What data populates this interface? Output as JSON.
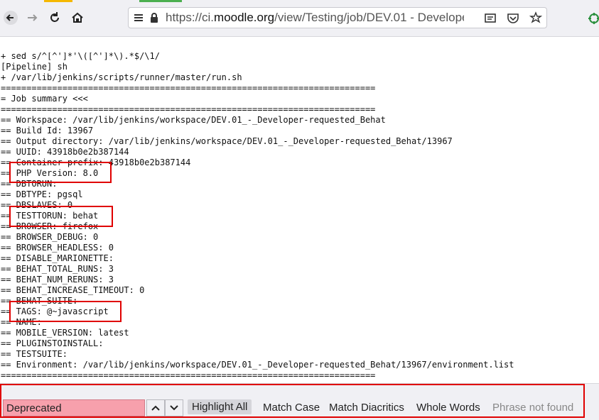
{
  "browser": {
    "url_prefix": "https://ci.",
    "url_host": "moodle.org",
    "url_path": "/view/Testing/job/DEV.01 - Develope"
  },
  "console": {
    "lines": [
      "+ sed s/^[^']*'\\([^']*\\).*$/\\1/",
      "[Pipeline] sh",
      "+ /var/lib/jenkins/scripts/runner/master/run.sh",
      "=========================================================================",
      "= Job summary <<<",
      "=========================================================================",
      "== Workspace: /var/lib/jenkins/workspace/DEV.01_-_Developer-requested_Behat",
      "== Build Id: 13967",
      "== Output directory: /var/lib/jenkins/workspace/DEV.01_-_Developer-requested_Behat/13967",
      "== UUID: 43918b0e2b387144",
      "== Container prefix: 43918b0e2b387144",
      "== PHP Version: 8.0",
      "== DBTORUN:",
      "== DBTYPE: pgsql",
      "== DBSLAVES: 0",
      "== TESTTORUN: behat",
      "== BROWSER: firefox",
      "== BROWSER_DEBUG: 0",
      "== BROWSER_HEADLESS: 0",
      "== DISABLE_MARIONETTE:",
      "== BEHAT_TOTAL_RUNS: 3",
      "== BEHAT_NUM_RERUNS: 3",
      "== BEHAT_INCREASE_TIMEOUT: 0",
      "== BEHAT_SUITE:",
      "== TAGS: @~javascript",
      "== NAME:",
      "== MOBILE_VERSION: latest",
      "== PLUGINSTOINSTALL:",
      "== TESTSUITE:",
      "== Environment: /var/lib/jenkins/workspace/DEV.01_-_Developer-requested_Behat/13967/environment.list",
      "========================================================================="
    ]
  },
  "findbar": {
    "query": "Deprecated",
    "highlight_all": "Highlight All",
    "match_case": "Match Case",
    "match_diacritics": "Match Diacritics",
    "whole_words": "Whole Words",
    "status": "Phrase not found"
  },
  "colors": {
    "highlight_box": "#e00000",
    "not_found_input": "#f7a0ac"
  }
}
